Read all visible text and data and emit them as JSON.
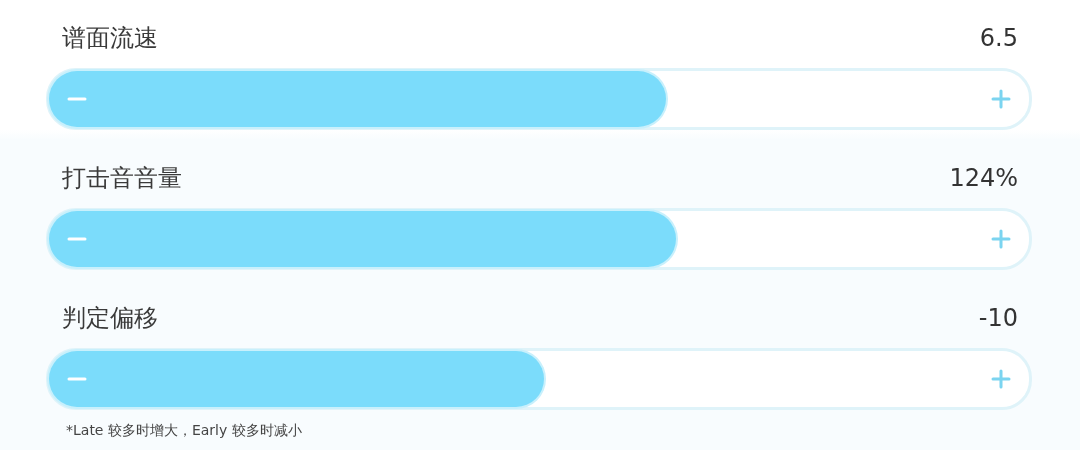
{
  "sliders": [
    {
      "label": "谱面流速",
      "reading": "6.5",
      "level": 0.63
    },
    {
      "label": "打击音音量",
      "reading": "124%",
      "level": 0.64
    },
    {
      "label": "判定偏移",
      "reading": "-10",
      "level": 0.505
    }
  ],
  "note": "*Late 较多时增大，Early 较多时减小"
}
